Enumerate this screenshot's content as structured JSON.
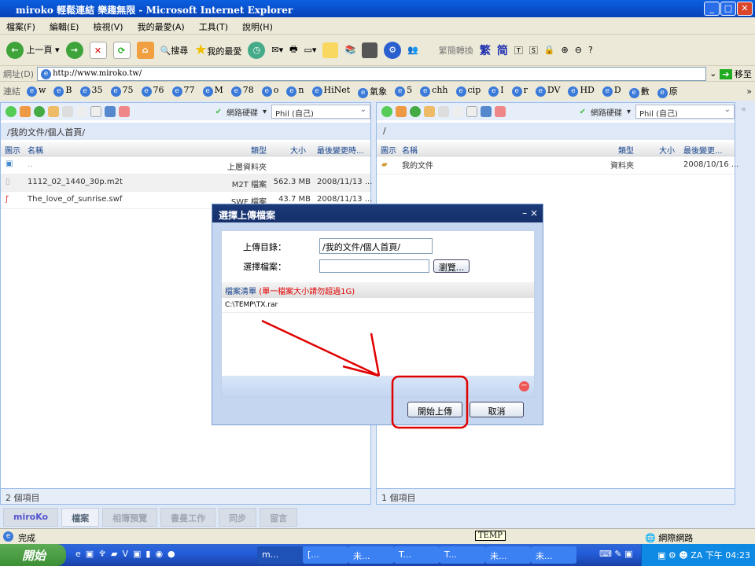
{
  "window": {
    "title": "miroko 輕鬆連結 樂趣無限 - Microsoft Internet Explorer"
  },
  "menu": [
    "檔案(F)",
    "編輯(E)",
    "檢視(V)",
    "我的最愛(A)",
    "工具(T)",
    "說明(H)"
  ],
  "toolbar": {
    "back": "上一頁",
    "search": "搜尋",
    "favorites": "我的最愛",
    "convert": "繁簡轉換",
    "trad": "繁",
    "simp": "简"
  },
  "address": {
    "label": "網址(D)",
    "url": "http://www.miroko.tw/",
    "go": "移至"
  },
  "links": {
    "label": "連結",
    "items": [
      "w",
      "B",
      "35",
      "75",
      "76",
      "77",
      "M",
      "78",
      "o",
      "n",
      "HiNet",
      "氣象",
      "5",
      "chh",
      "cip",
      "I",
      "r",
      "DV",
      "HD",
      "D",
      "數",
      "原"
    ]
  },
  "left_panel": {
    "drive": "網路硬碟",
    "user": "Phil (自己)",
    "path": "/我的文件/個人首頁/",
    "columns": [
      "圖示",
      "名稱",
      "類型",
      "大小",
      "最後變更時..."
    ],
    "rows": [
      {
        "name": "..",
        "type": "上層資料夾",
        "size": "",
        "date": ""
      },
      {
        "name": "1112_02_1440_30p.m2t",
        "type": "M2T 檔案",
        "size": "562.3 MB",
        "date": "2008/11/13 ..."
      },
      {
        "name": "The_love_of_sunrise.swf",
        "type": "SWF 檔案",
        "size": "43.7 MB",
        "date": "2008/11/13 ..."
      }
    ],
    "status": "2 個項目"
  },
  "right_panel": {
    "drive": "網路硬碟",
    "user": "Phil (自己)",
    "path": "/",
    "columns": [
      "圖示",
      "名稱",
      "類型",
      "大小",
      "最後變更..."
    ],
    "rows": [
      {
        "name": "我的文件",
        "type": "資料夾",
        "size": "",
        "date": "2008/10/16 ..."
      }
    ],
    "status": "1 個項目"
  },
  "tabs": [
    "miroKo",
    "檔案",
    "相簿預覽",
    "書曼工作",
    "同步",
    "留言"
  ],
  "dialog": {
    "title": "選擇上傳檔案",
    "dir_label": "上傳目錄：",
    "dir_value": "/我的文件/個人首頁/",
    "file_label": "選擇檔案：",
    "file_value": "",
    "browse": "瀏覽...",
    "list_title": "檔案清單",
    "list_note": "(單一檔案大小請勿超過1G)",
    "files": [
      "C:\\TEMP\\TX.rar"
    ],
    "start": "開始上傳",
    "cancel": "取消"
  },
  "statusbar": {
    "text": "完成",
    "tooltip": "TEMP",
    "zone": "網際網路"
  },
  "taskbar": {
    "start": "開始",
    "tasks": [
      "m...",
      "[...",
      "未...",
      "T...",
      "T...",
      "未...",
      "未..."
    ],
    "clock": "下午 04:23"
  },
  "colors": {
    "accent": "#15428b",
    "annotation": "#e00000",
    "warning": "#e00000"
  }
}
